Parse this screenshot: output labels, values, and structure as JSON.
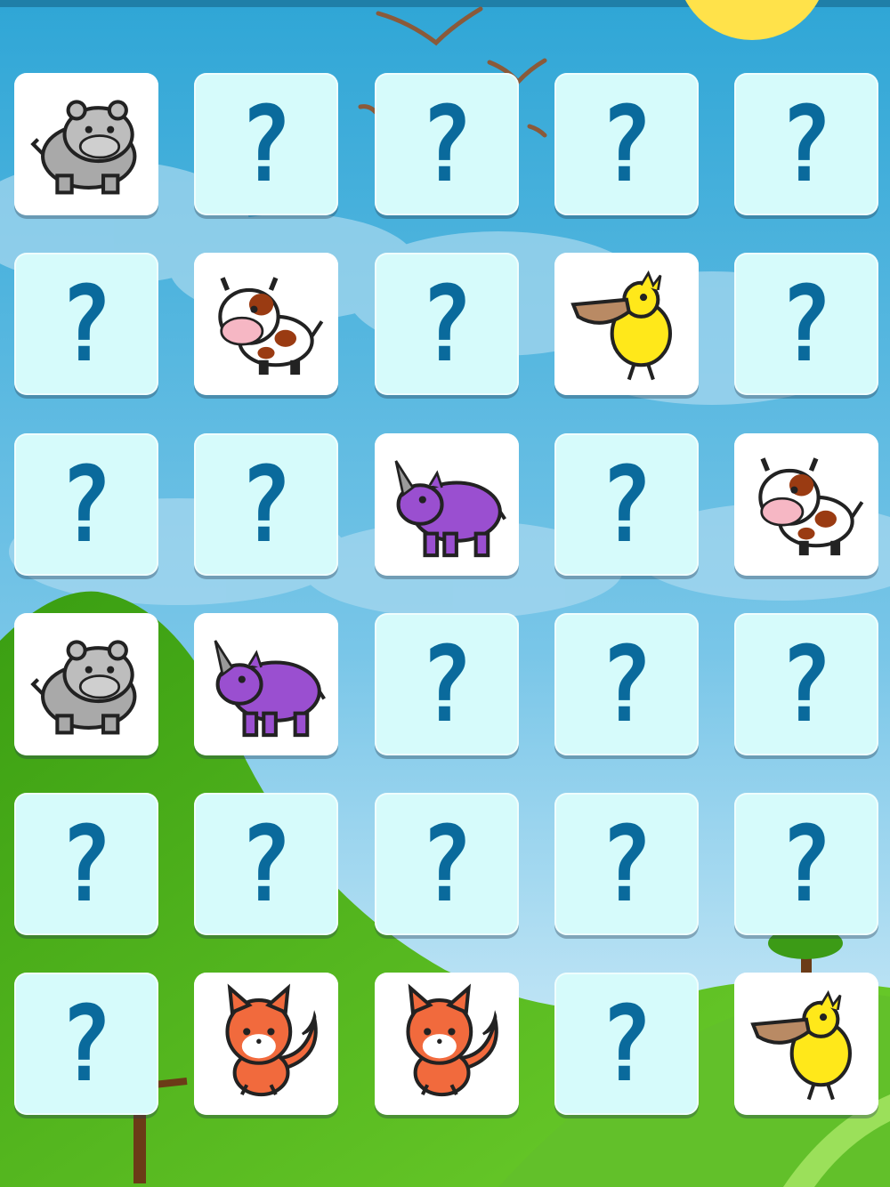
{
  "game": {
    "hidden_symbol": "?",
    "colors": {
      "sky_top": "#2fa6d6",
      "sky_bottom": "#dff2fb",
      "hill": "#4fb320",
      "card_hidden": "#d6fbfb",
      "card_revealed": "#ffffff",
      "question_mark": "#0a6a9c",
      "sun": "#ffe24a"
    },
    "columns": 5,
    "rows": 6,
    "cards": [
      {
        "state": "revealed",
        "animal": "hippo"
      },
      {
        "state": "hidden"
      },
      {
        "state": "hidden"
      },
      {
        "state": "hidden"
      },
      {
        "state": "hidden"
      },
      {
        "state": "hidden"
      },
      {
        "state": "revealed",
        "animal": "cow"
      },
      {
        "state": "hidden"
      },
      {
        "state": "revealed",
        "animal": "pelican"
      },
      {
        "state": "hidden"
      },
      {
        "state": "hidden"
      },
      {
        "state": "hidden"
      },
      {
        "state": "revealed",
        "animal": "rhino"
      },
      {
        "state": "hidden"
      },
      {
        "state": "revealed",
        "animal": "cow"
      },
      {
        "state": "revealed",
        "animal": "hippo"
      },
      {
        "state": "revealed",
        "animal": "rhino"
      },
      {
        "state": "hidden"
      },
      {
        "state": "hidden"
      },
      {
        "state": "hidden"
      },
      {
        "state": "hidden"
      },
      {
        "state": "hidden"
      },
      {
        "state": "hidden"
      },
      {
        "state": "hidden"
      },
      {
        "state": "hidden"
      },
      {
        "state": "hidden"
      },
      {
        "state": "revealed",
        "animal": "fox"
      },
      {
        "state": "revealed",
        "animal": "fox"
      },
      {
        "state": "hidden"
      },
      {
        "state": "revealed",
        "animal": "pelican"
      }
    ]
  }
}
